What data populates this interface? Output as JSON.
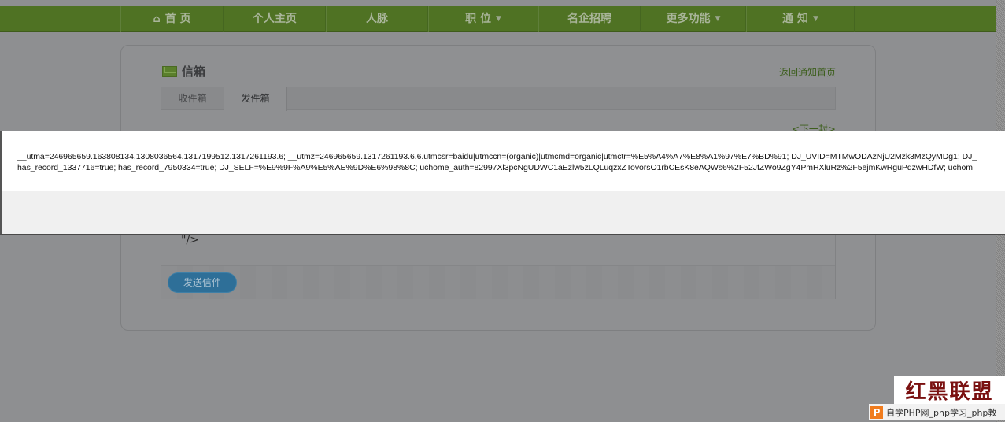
{
  "nav": {
    "items": [
      {
        "label": "首 页",
        "icon": "home-icon",
        "has_dropdown": false
      },
      {
        "label": "个人主页",
        "has_dropdown": false
      },
      {
        "label": "人脉",
        "has_dropdown": false
      },
      {
        "label": "职 位",
        "has_dropdown": true
      },
      {
        "label": "名企招聘",
        "has_dropdown": false
      },
      {
        "label": "更多功能",
        "has_dropdown": true
      },
      {
        "label": "通 知",
        "has_dropdown": true
      }
    ],
    "dropdown_arrow": "▼",
    "home_glyph": "⌂"
  },
  "mailbox": {
    "title": "信箱",
    "back_link": "返回通知首页",
    "tabs": [
      {
        "label": "收件箱",
        "active": false
      },
      {
        "label": "发件箱",
        "active": true
      }
    ],
    "next_link": "<下一封>",
    "code_fragment": "\"/>",
    "send_button": "发送信件"
  },
  "dialog": {
    "line1": "__utma=246965659.163808134.1308036564.1317199512.1317261193.6; __utmz=246965659.1317261193.6.6.utmcsr=baidu|utmccn=(organic)|utmcmd=organic|utmctr=%E5%A4%A7%E8%A1%97%E7%BD%91; DJ_UVID=MTMwODAzNjU2Mzk3MzQyMDg1; DJ_",
    "line2": "has_record_1337716=true; has_record_7950334=true; DJ_SELF=%E9%9F%A9%E5%AE%9D%E6%98%8C; uchome_auth=82997Xl3pcNgUDWC1aEzlw5zLQLuqzxZTovorsO1rbCEsK8eAQWs6%2F52JfZWo9ZgY4PmHXluRz%2F5ejmKwRguPqzwHDfW; uchom"
  },
  "watermark": {
    "logo_text": "红黑联盟",
    "p_badge": "P",
    "caption": "自学PHP网_php学习_php教"
  }
}
